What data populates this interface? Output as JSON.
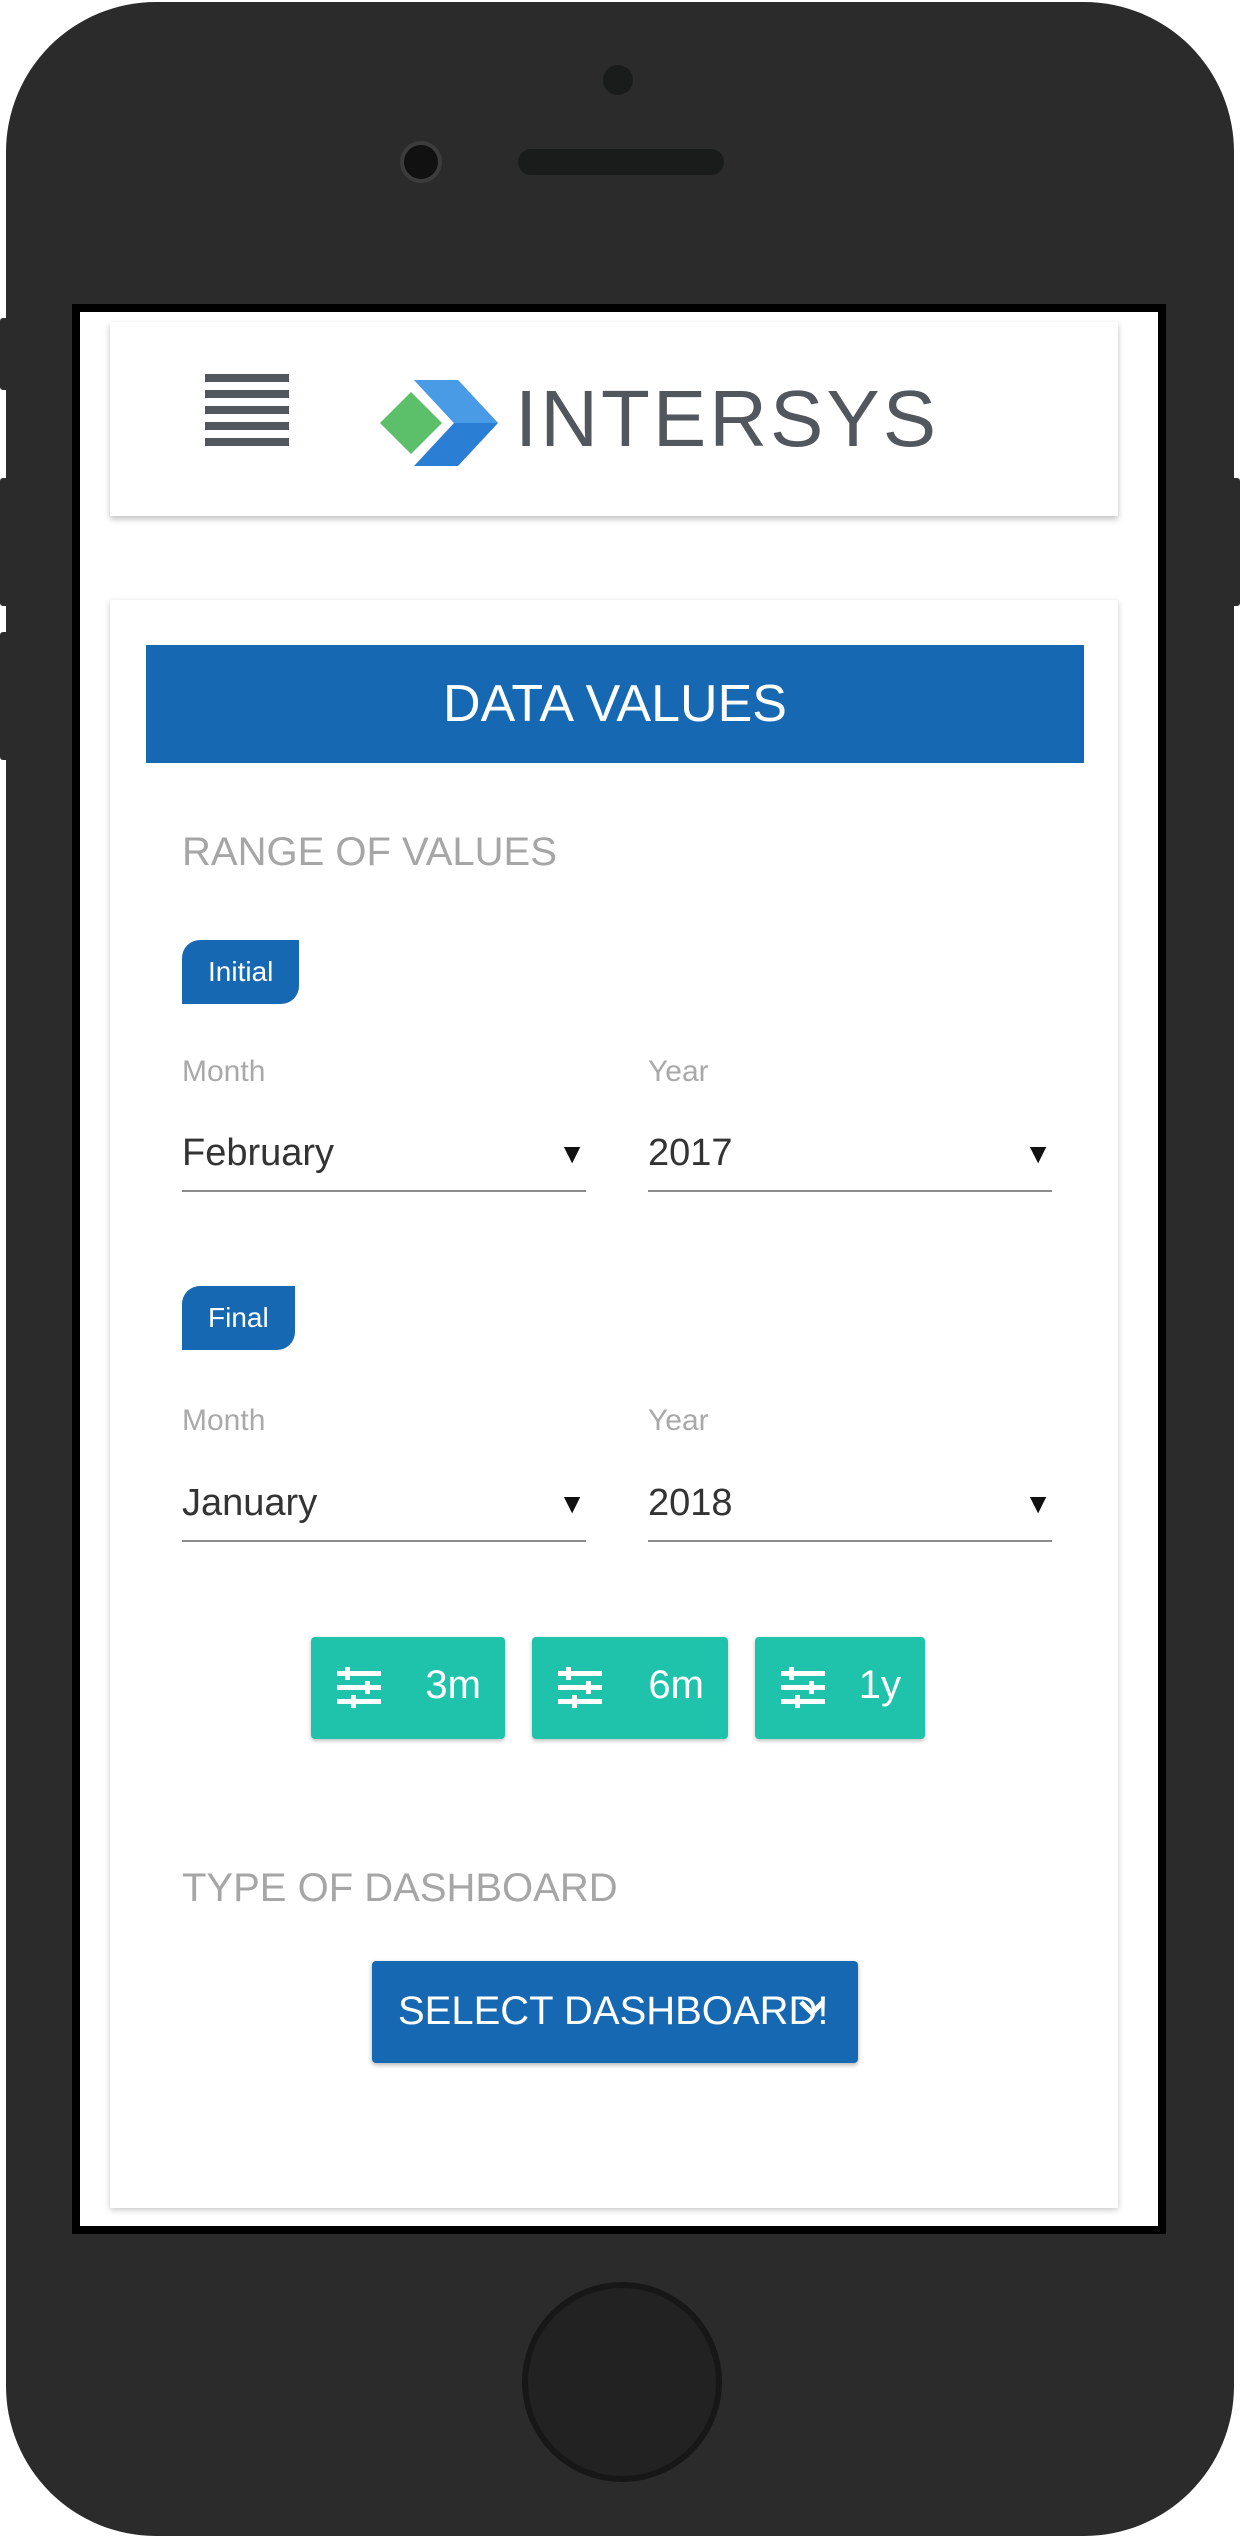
{
  "app": {
    "brand": "INTERSYS",
    "colors": {
      "primary": "#1768b3",
      "accent": "#1fc3ab",
      "logo_green": "#5cbf6a",
      "logo_blue": "#2a7fd4",
      "text_gray": "#52575e"
    }
  },
  "header": {
    "menu_icon": "hamburger-menu-icon",
    "logo_icon": "intersys-logo-mark"
  },
  "card": {
    "title": "DATA VALUES",
    "range_label": "RANGE OF VALUES",
    "initial": {
      "badge": "Initial",
      "month_label": "Month",
      "month_value": "February",
      "year_label": "Year",
      "year_value": "2017"
    },
    "final": {
      "badge": "Final",
      "month_label": "Month",
      "month_value": "January",
      "year_label": "Year",
      "year_value": "2018"
    },
    "quick_ranges": [
      {
        "label": "3m",
        "icon": "tune-icon"
      },
      {
        "label": "6m",
        "icon": "tune-icon"
      },
      {
        "label": "1y",
        "icon": "tune-icon"
      }
    ],
    "dashboard_label": "TYPE OF DASHBOARD",
    "dashboard_button": "SELECT DASHBOARD!",
    "dropdown_arrow": "▼"
  }
}
